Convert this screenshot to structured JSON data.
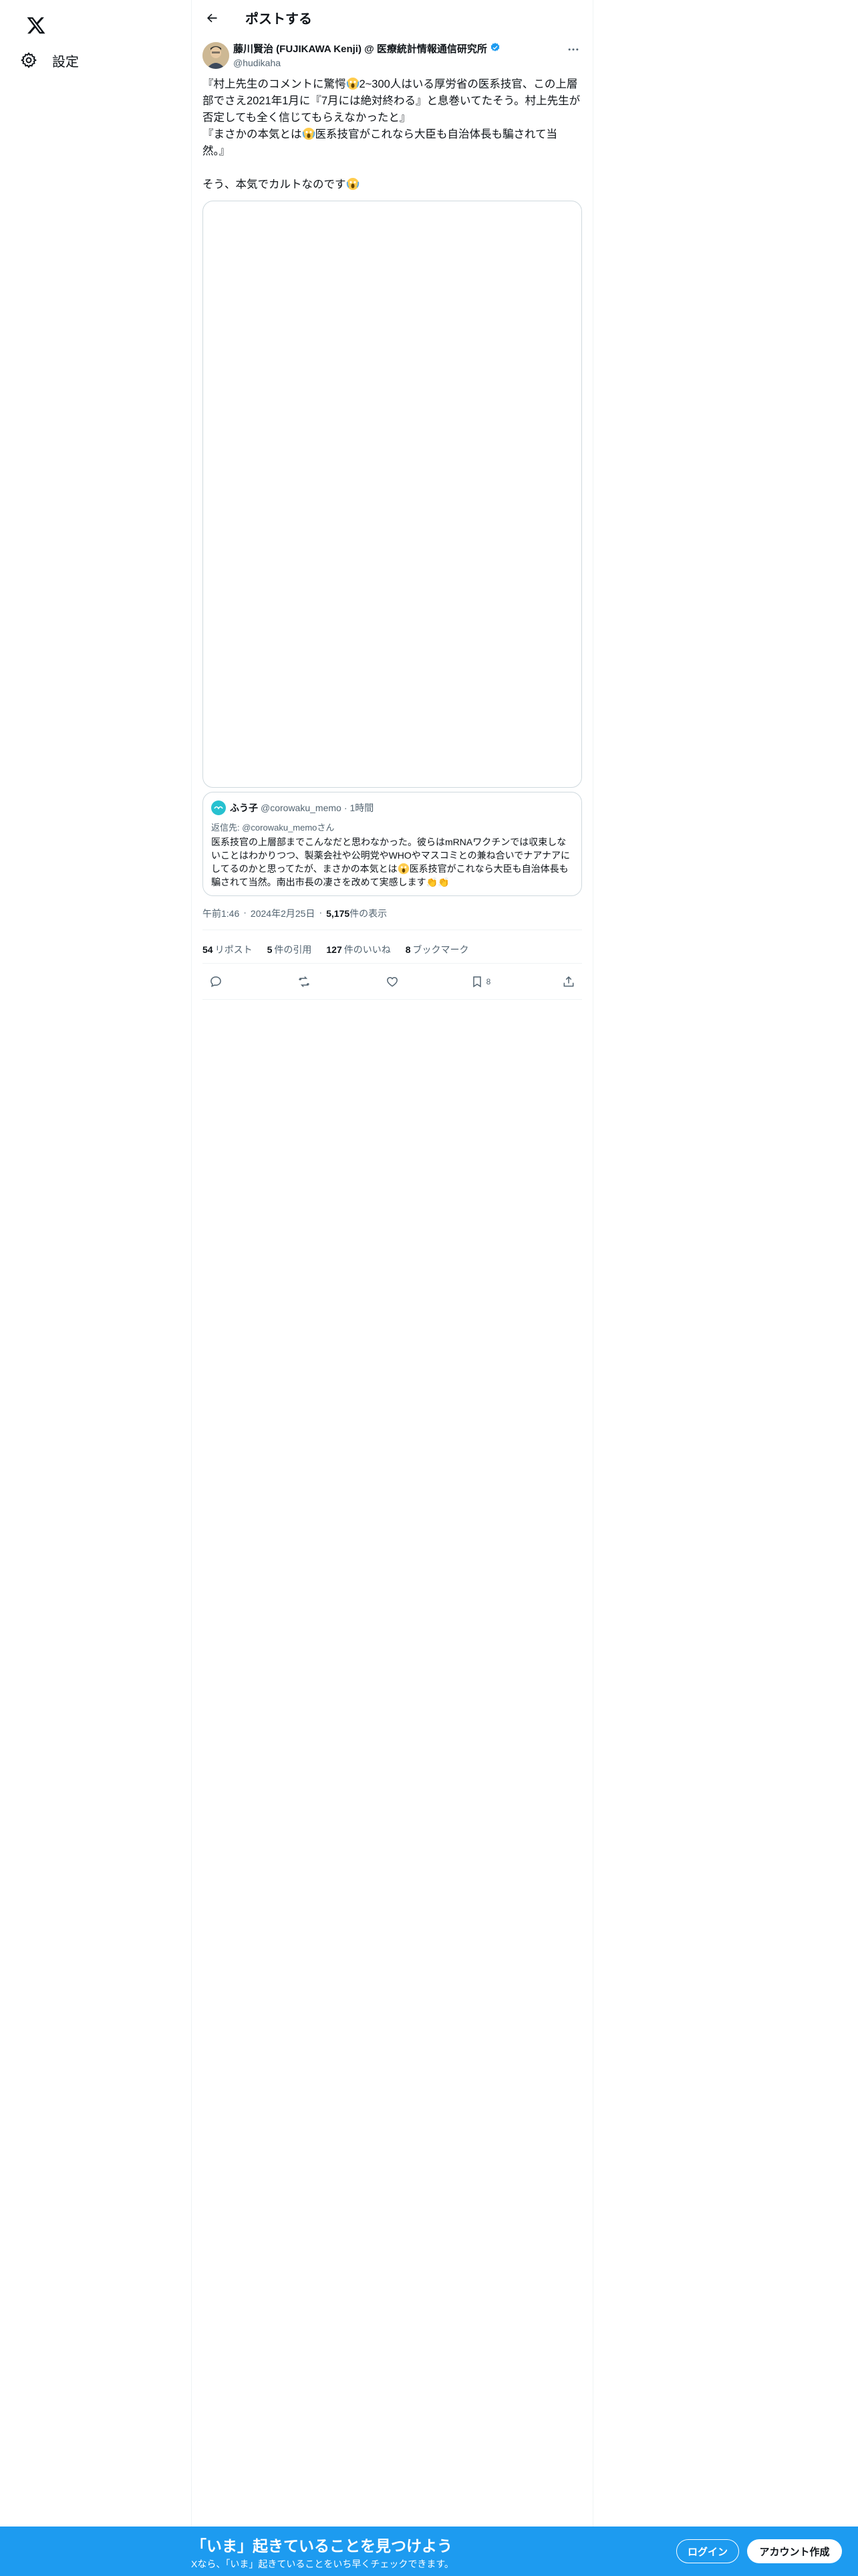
{
  "sidebar": {
    "settings_label": "設定"
  },
  "header": {
    "title": "ポストする"
  },
  "tweet": {
    "author_name": "藤川賢治 (FUJIKAWA Kenji) @ 医療統計情報通信研究所",
    "handle": "@hudikaha",
    "text_1": "『村上先生のコメントに驚愕",
    "text_2": "2~300人はいる厚労省の医系技官、この上層部でさえ2021年1月に『7月には絶対終わる』と息巻いてたそう。村上先生が否定しても全く信じてもらえなかったと』\n『まさかの本気とは",
    "text_3": "医系技官がこれなら大臣も自治体長も騙されて当然。』\n\nそう、本気でカルトなのです",
    "emoji_name": "scream-emoji"
  },
  "quote": {
    "name": "ふう子",
    "handle": "@corowaku_memo",
    "time": "1時間",
    "reply_prefix": "返信先: ",
    "reply_mention": "@corowaku_memoさん",
    "text_1": "医系技官の上層部までこんなだと思わなかった。彼らはmRNAワクチンでは収束しないことはわかりつつ、製薬会社や公明党やWHOやマスコミとの兼ね合いでナアナアにしてるのかと思ってたが、まさかの本気とは",
    "text_2": "医系技官がこれなら大臣も自治体長も騙されて当然。南出市長の凄さを改めて実感します",
    "text_3": "👏👏"
  },
  "meta": {
    "time": "午前1:46",
    "date": "2024年2月25日",
    "views_count": "5,175",
    "views_label": "件の表示",
    "sep": "·"
  },
  "stats": {
    "reposts_count": "54",
    "reposts_label": "リポスト",
    "quotes_count": "5",
    "quotes_label": "件の引用",
    "likes_count": "127",
    "likes_label": "件のいいね",
    "bookmarks_count": "8",
    "bookmarks_label": "ブックマーク"
  },
  "actions": {
    "bookmark_count": "8"
  },
  "bottom_bar": {
    "title": "「いま」起きていることを見つけよう",
    "subtitle": "Xなら、「いま」起きていることをいち早くチェックできます。",
    "login_label": "ログイン",
    "signup_label": "アカウント作成"
  },
  "colors": {
    "accent": "#1d9bf0",
    "text": "#0f1419",
    "secondary": "#536471",
    "border": "#cfd9de"
  }
}
